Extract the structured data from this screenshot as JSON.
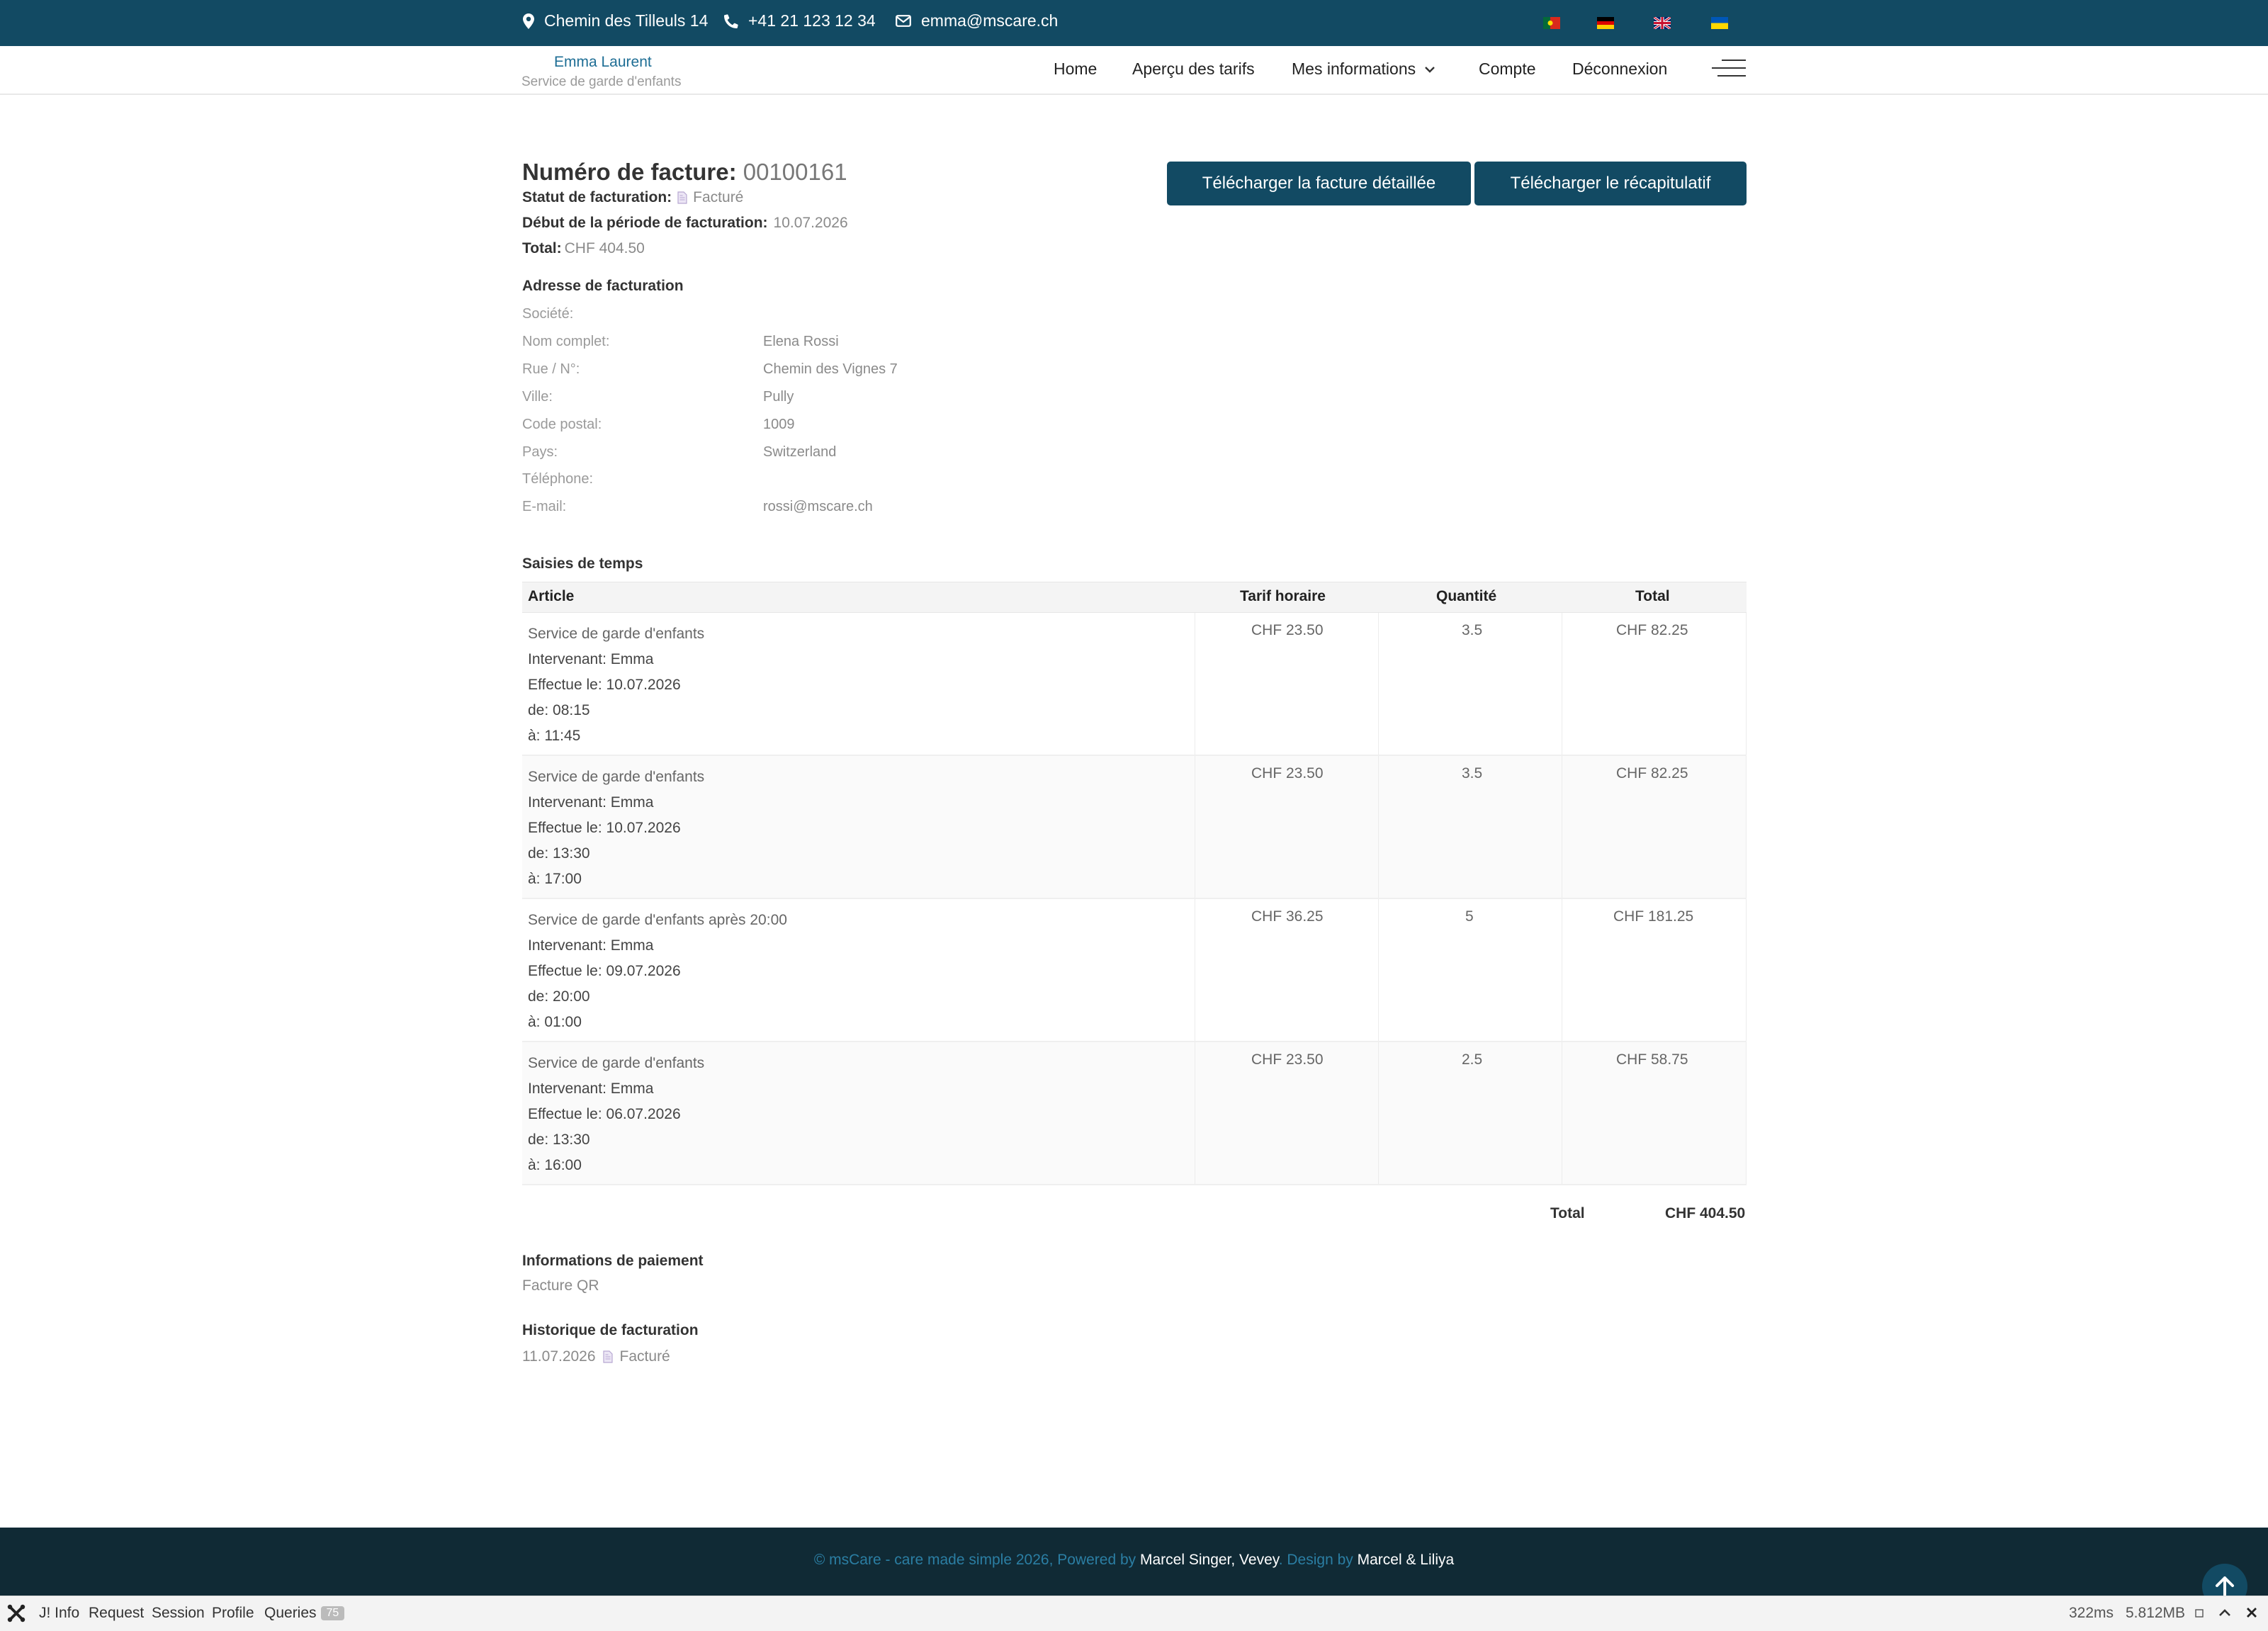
{
  "topbar": {
    "address": "Chemin des Tilleuls 14",
    "phone": "+41 21 123 12 34",
    "email": "emma@mscare.ch",
    "languages": [
      "pt",
      "de",
      "en",
      "uk"
    ]
  },
  "navbar": {
    "brand_name": "Emma Laurent",
    "brand_subtitle": "Service de garde d'enfants",
    "links": [
      "Home",
      "Aperçu des tarifs",
      "Mes informations",
      "Compte",
      "Déconnexion"
    ]
  },
  "invoice": {
    "number_label": "Numéro de facture:",
    "number": "00100161",
    "status_label": "Statut de facturation:",
    "status": "Facturé",
    "period_label": "Début de la période de facturation:",
    "period": "10.07.2026",
    "total_label": "Total:",
    "total": "CHF 404.50",
    "download_detailed": "Télécharger la facture détaillée",
    "download_summary": "Télécharger le récapitulatif"
  },
  "address": {
    "title": "Adresse de facturation",
    "rows": [
      {
        "label": "Société:",
        "value": ""
      },
      {
        "label": "Nom complet:",
        "value": "Elena Rossi"
      },
      {
        "label": "Rue / N°:",
        "value": "Chemin des Vignes 7"
      },
      {
        "label": "Ville:",
        "value": "Pully"
      },
      {
        "label": "Code postal:",
        "value": "1009"
      },
      {
        "label": "Pays:",
        "value": "Switzerland"
      },
      {
        "label": "Téléphone:",
        "value": ""
      },
      {
        "label": "E-mail:",
        "value": "rossi@mscare.ch"
      }
    ]
  },
  "time_entries": {
    "title": "Saisies de temps",
    "headers": {
      "article": "Article",
      "rate": "Tarif horaire",
      "qty": "Quantité",
      "total": "Total"
    },
    "rows": [
      {
        "name": "Service de garde d'enfants",
        "worker": "Intervenant: Emma",
        "date": "Effectue le: 10.07.2026",
        "from": "de: 08:15",
        "to": "à: 11:45",
        "rate": "CHF 23.50",
        "qty": "3.5",
        "total": "CHF 82.25"
      },
      {
        "name": "Service de garde d'enfants",
        "worker": "Intervenant: Emma",
        "date": "Effectue le: 10.07.2026",
        "from": "de: 13:30",
        "to": "à: 17:00",
        "rate": "CHF 23.50",
        "qty": "3.5",
        "total": "CHF 82.25"
      },
      {
        "name": "Service de garde d'enfants après 20:00",
        "worker": "Intervenant: Emma",
        "date": "Effectue le: 09.07.2026",
        "from": "de: 20:00",
        "to": "à: 01:00",
        "rate": "CHF 36.25",
        "qty": "5",
        "total": "CHF 181.25"
      },
      {
        "name": "Service de garde d'enfants",
        "worker": "Intervenant: Emma",
        "date": "Effectue le: 06.07.2026",
        "from": "de: 13:30",
        "to": "à: 16:00",
        "rate": "CHF 23.50",
        "qty": "2.5",
        "total": "CHF 58.75"
      }
    ],
    "grand_total_label": "Total",
    "grand_total": "CHF 404.50"
  },
  "payment": {
    "title": "Informations de paiement",
    "method": "Facture QR"
  },
  "history": {
    "title": "Historique de facturation",
    "date": "11.07.2026",
    "status": "Facturé"
  },
  "footer": {
    "prefix": "© msCare - care made simple 2026, Powered by",
    "powered_by": "Marcel Singer, Vevey",
    "design_label": ". Design by",
    "designer": "Marcel & Liliya"
  },
  "debugbar": {
    "items": [
      "J! Info",
      "Request",
      "Session",
      "Profile",
      "Queries"
    ],
    "queries_count": "75",
    "time": "322ms",
    "memory": "5.812MB"
  },
  "colors": {
    "primary": "#124a63",
    "footer_bg": "#102a35",
    "link": "#2b7ea3"
  }
}
